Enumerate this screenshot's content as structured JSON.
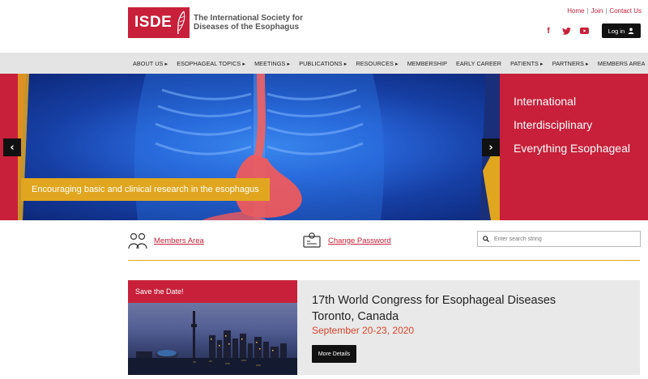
{
  "brand": {
    "logo_mark": "ISDE",
    "name_line1": "The International Society for",
    "name_line2": "Diseases of the Esophagus",
    "accent": "#c8203a",
    "gold": "#e1a61f"
  },
  "top_links": [
    "Home",
    "Join",
    "Contact Us"
  ],
  "socials": [
    {
      "icon": "facebook-icon",
      "glyph": "f"
    },
    {
      "icon": "twitter-icon",
      "glyph": "t"
    },
    {
      "icon": "youtube-icon",
      "glyph": "▶"
    }
  ],
  "login": {
    "label": "Log in",
    "icon": "user-icon"
  },
  "nav": [
    "ABOUT US ▸",
    "ESOPHAGEAL TOPICS ▸",
    "MEETINGS ▸",
    "PUBLICATIONS ▸",
    "RESOURCES ▸",
    "MEMBERSHIP",
    "EARLY CAREER",
    "PATIENTS ▸",
    "PARTNERS ▸",
    "MEMBERS AREA"
  ],
  "hero": {
    "lines": [
      "International",
      "Interdisciplinary",
      "Everything Esophageal"
    ],
    "caption": "Encouraging basic and clinical research in the esophagus",
    "prev_icon": "chevron-left-icon",
    "next_icon": "chevron-right-icon"
  },
  "quick_links": {
    "members_area": "Members Area",
    "change_password": "Change Password"
  },
  "search": {
    "placeholder": "Enter search string"
  },
  "congress": {
    "banner": "Save the Date!",
    "title_line1": "17th World Congress for Esophageal Diseases",
    "title_line2": "Toronto, Canada",
    "date": "September 20-23, 2020",
    "button": "More Details"
  }
}
